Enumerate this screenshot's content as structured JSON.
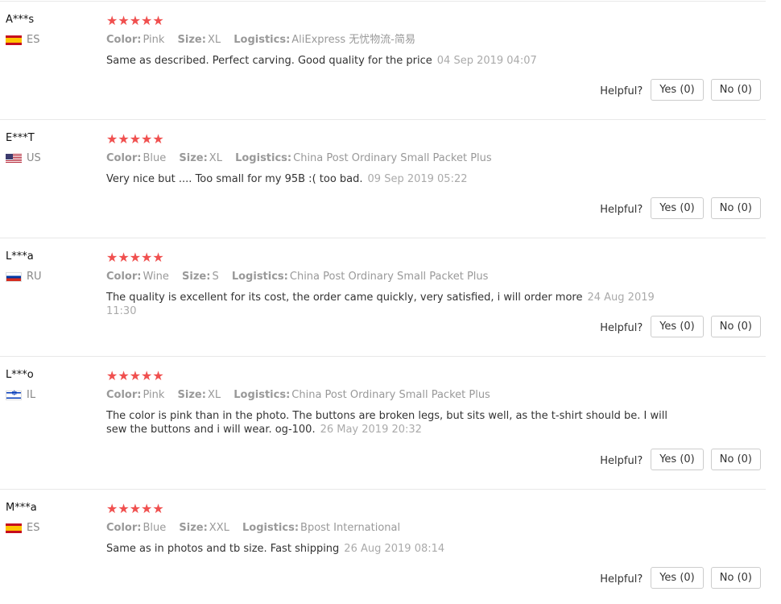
{
  "helpful_label": "Helpful?",
  "star_glyphs": "★★★★★",
  "reviews": [
    {
      "user": "A***s",
      "country": "ES",
      "flag": "es-flag",
      "color_label": "Color:",
      "color": "Pink",
      "size_label": "Size:",
      "size": "XL",
      "logistics_label": "Logistics:",
      "logistics": "AliExpress 无忧物流-简易",
      "text": "Same as described. Perfect carving. Good quality for the price",
      "date": "04 Sep 2019 04:07",
      "yes": "Yes (0)",
      "no": "No (0)"
    },
    {
      "user": "E***T",
      "country": "US",
      "flag": "us-flag",
      "color_label": "Color:",
      "color": "Blue",
      "size_label": "Size:",
      "size": "XL",
      "logistics_label": "Logistics:",
      "logistics": "China Post Ordinary Small Packet Plus",
      "text": "Very nice but .... Too small for my 95B :( too bad.",
      "date": "09 Sep 2019 05:22",
      "yes": "Yes (0)",
      "no": "No (0)"
    },
    {
      "user": "L***a",
      "country": "RU",
      "flag": "ru-flag",
      "color_label": "Color:",
      "color": "Wine",
      "size_label": "Size:",
      "size": "S",
      "logistics_label": "Logistics:",
      "logistics": "China Post Ordinary Small Packet Plus",
      "text": "The quality is excellent for its cost, the order came quickly, very satisfied, i will order more",
      "date": "24 Aug 2019 11:30",
      "yes": "Yes (0)",
      "no": "No (0)"
    },
    {
      "user": "L***o",
      "country": "IL",
      "flag": "il-flag",
      "color_label": "Color:",
      "color": "Pink",
      "size_label": "Size:",
      "size": "XL",
      "logistics_label": "Logistics:",
      "logistics": "China Post Ordinary Small Packet Plus",
      "text": "The color is pink than in the photo. The buttons are broken legs, but sits well, as the t-shirt should be. I will sew the buttons and i will wear. og-100.",
      "date": "26 May 2019 20:32",
      "yes": "Yes (0)",
      "no": "No (0)"
    },
    {
      "user": "M***a",
      "country": "ES",
      "flag": "es-flag",
      "color_label": "Color:",
      "color": "Blue",
      "size_label": "Size:",
      "size": "XXL",
      "logistics_label": "Logistics:",
      "logistics": "Bpost International",
      "text": "Same as in photos and tb size. Fast shipping",
      "date": "26 Aug 2019 08:14",
      "yes": "Yes (0)",
      "no": "No (0)"
    }
  ],
  "colors": {
    "star": "#f0504f",
    "divider": "#e8e8e8",
    "muted": "#999999"
  }
}
